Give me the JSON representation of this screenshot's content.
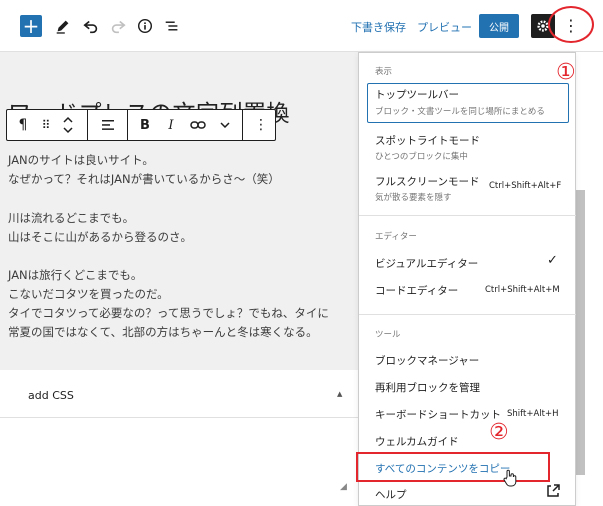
{
  "toolbar": {
    "save_draft": "下書き保存",
    "preview": "プレビュー",
    "publish": "公開"
  },
  "annotations": {
    "step1": "①",
    "step2": "②"
  },
  "editor": {
    "title": "ワードプレスの文字列置換",
    "paragraphs": [
      "JANのサイトは良いサイト。",
      "なぜかって？それはJANが書いているからさ〜（笑）",
      "川は流れるどこまでも。",
      "山はそこに山があるから登るのさ。",
      "JANは旅行くどこまでも。",
      "こないだコタツを買ったのだ。",
      "タイでコタツって必要なの？って思うでしょ？でもね、タイに",
      "常夏の国ではなくて、北部の方はちゃーんと冬は寒くなる。"
    ]
  },
  "block_toolbar": {
    "paragraph_icon": "¶",
    "drag_icon": "⠿",
    "bold": "B",
    "italic": "I"
  },
  "meta_box": {
    "title": "add CSS"
  },
  "menu": {
    "view_label": "表示",
    "top_toolbar": "トップツールバー",
    "top_toolbar_desc": "ブロック・文書ツールを同じ場所にまとめる",
    "spotlight": "スポットライトモード",
    "spotlight_desc": "ひとつのブロックに集中",
    "fullscreen": "フルスクリーンモード",
    "fullscreen_desc": "気が散る要素を隠す",
    "fullscreen_shortcut": "Ctrl+Shift+Alt+F",
    "editor_label": "エディター",
    "visual_editor": "ビジュアルエディター",
    "code_editor": "コードエディター",
    "code_editor_shortcut": "Ctrl+Shift+Alt+M",
    "tools_label": "ツール",
    "block_manager": "ブロックマネージャー",
    "reusable_blocks": "再利用ブロックを管理",
    "keyboard_shortcuts": "キーボードショートカット",
    "keyboard_shortcuts_shortcut": "Shift+Alt+H",
    "welcome_guide": "ウェルカムガイド",
    "copy_all": "すべてのコンテンツをコピー",
    "help": "ヘルプ"
  },
  "icons": {
    "add": "plus-icon",
    "edit": "pencil-icon",
    "undo": "undo-icon",
    "redo": "redo-icon",
    "info": "info-icon",
    "outline": "list-view-icon",
    "settings": "gear-icon",
    "more": "vertical-ellipsis-icon",
    "check": "checkmark-icon",
    "external": "external-link-icon"
  },
  "colors": {
    "accent": "#2271b1",
    "annotation_red": "#e3262d",
    "canvas_bg": "#f0f0f0"
  }
}
